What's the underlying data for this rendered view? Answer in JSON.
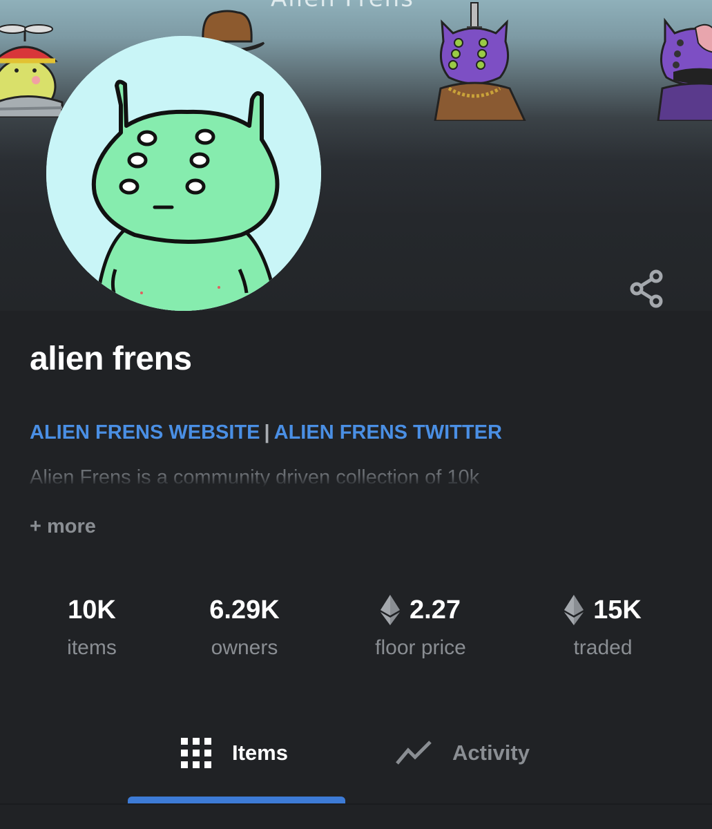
{
  "banner": {
    "title_fragment": "Alien Frens"
  },
  "collection": {
    "name": "alien frens"
  },
  "links": {
    "website": "ALIEN FRENS WEBSITE",
    "separator": "|",
    "twitter": "ALIEN FRENS TWITTER"
  },
  "description": "Alien Frens is a community driven collection of 10k",
  "more_label": "+ more",
  "stats": {
    "items": {
      "value": "10K",
      "label": "items"
    },
    "owners": {
      "value": "6.29K",
      "label": "owners"
    },
    "floor_price": {
      "value": "2.27",
      "label": "floor price",
      "icon": "ethereum-icon"
    },
    "traded": {
      "value": "15K",
      "label": "traded",
      "icon": "ethereum-icon"
    }
  },
  "tabs": [
    {
      "label": "Items",
      "icon": "grid-icon",
      "active": true
    },
    {
      "label": "Activity",
      "icon": "activity-icon",
      "active": false
    }
  ],
  "colors": {
    "background": "#202225",
    "link": "#4a8fe4",
    "active_tab_indicator": "#3d7bd6",
    "avatar_bg": "#c9f5f7",
    "alien_green": "#86ecae"
  }
}
